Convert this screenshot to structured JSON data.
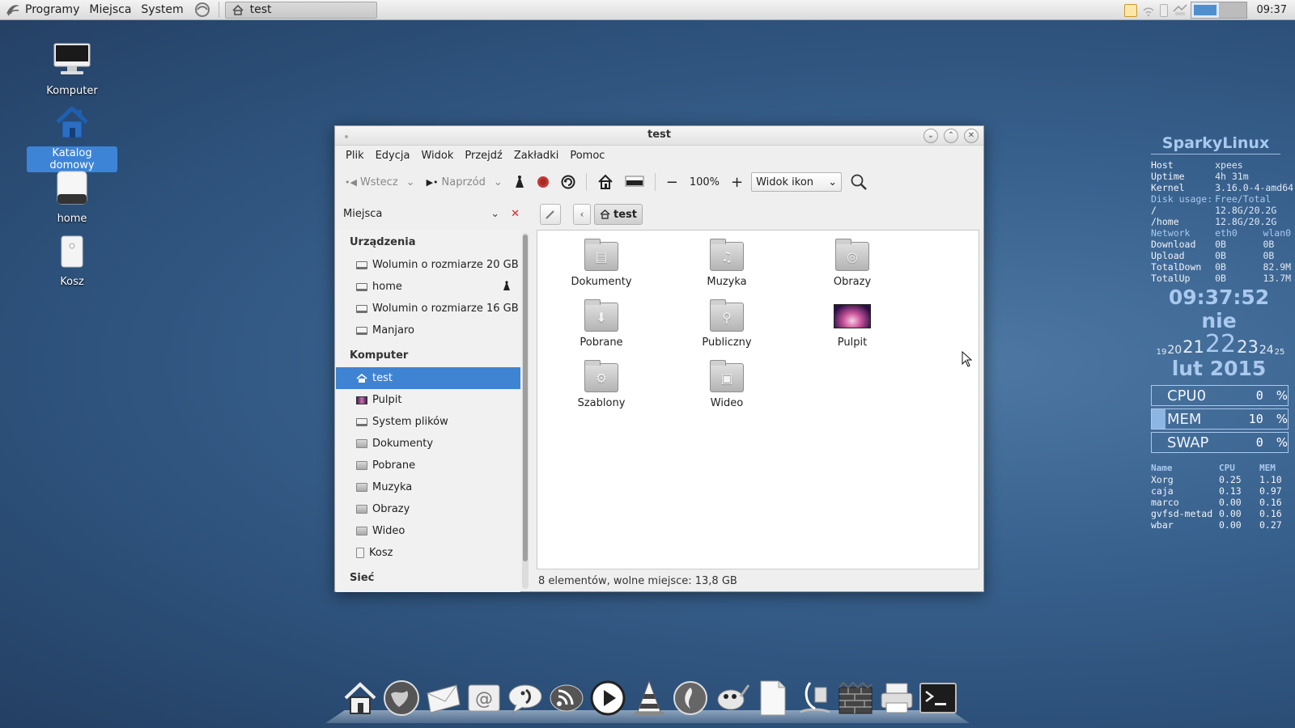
{
  "panel": {
    "menus": [
      "Programy",
      "Miejsca",
      "System"
    ],
    "task_title": "test",
    "clock": "09:37"
  },
  "desktop_icons": [
    {
      "label": "Komputer"
    },
    {
      "label": "Katalog domowy",
      "selected": true
    },
    {
      "label": "home"
    },
    {
      "label": "Kosz"
    }
  ],
  "window": {
    "title": "test",
    "menubar": [
      "Plik",
      "Edycja",
      "Widok",
      "Przejdź",
      "Zakładki",
      "Pomoc"
    ],
    "toolbar": {
      "back_label": "Wstecz",
      "forward_label": "Naprzód",
      "zoom": "100%",
      "view_mode": "Widok ikon"
    },
    "sidebar_combo": "Miejsca",
    "breadcrumb": "test",
    "sidebar": {
      "devices_header": "Urządzenia",
      "devices": [
        "Wolumin o rozmiarze 20 GB",
        "home",
        "Wolumin o rozmiarze 16 GB",
        "Manjaro"
      ],
      "computer_header": "Komputer",
      "computer": [
        "test",
        "Pulpit",
        "System plików",
        "Dokumenty",
        "Pobrane",
        "Muzyka",
        "Obrazy",
        "Wideo",
        "Kosz"
      ],
      "network_header": "Sieć"
    },
    "files": [
      {
        "name": "Dokumenty",
        "icon": "document-folder-icon"
      },
      {
        "name": "Muzyka",
        "icon": "music-folder-icon"
      },
      {
        "name": "Obrazy",
        "icon": "pictures-folder-icon"
      },
      {
        "name": "Pobrane",
        "icon": "downloads-folder-icon"
      },
      {
        "name": "Publiczny",
        "icon": "public-folder-icon"
      },
      {
        "name": "Pulpit",
        "icon": "desktop-folder-icon"
      },
      {
        "name": "Szablony",
        "icon": "templates-folder-icon"
      },
      {
        "name": "Wideo",
        "icon": "video-folder-icon"
      }
    ],
    "status": "8 elementów, wolne miejsce: 13,8 GB"
  },
  "conky": {
    "brand": "SparkyLinux",
    "host_k": "Host",
    "host_v": "xpees",
    "uptime_k": "Uptime",
    "uptime_v": "4h 31m",
    "kernel_k": "Kernel",
    "kernel_v": "3.16.0-4-amd64",
    "disk_k": "Disk usage:",
    "disk_v": "Free/Total",
    "root_k": "/",
    "root_v": "12.8G/20.2G",
    "home_k": "/home",
    "home_v": "12.8G/20.2G",
    "net_k": "Network",
    "net_eth": "eth0",
    "net_wlan": "wlan0",
    "down_k": "Download",
    "down_eth": "0B",
    "down_wlan": "0B",
    "up_k": "Upload",
    "up_eth": "0B",
    "up_wlan": "0B",
    "tdown_k": "TotalDown",
    "tdown_eth": "0B",
    "tdown_wlan": "82.9M",
    "tup_k": "TotalUp",
    "tup_eth": "0B",
    "tup_wlan": "13.7M",
    "time": "09:37:52",
    "day": "nie",
    "calendar": [
      "19",
      "20",
      "21",
      "22",
      "23",
      "24",
      "25"
    ],
    "month": "lut 2015",
    "meters": [
      {
        "name": "CPU0",
        "value": "0",
        "pct": "%",
        "fill": 0
      },
      {
        "name": "MEM",
        "value": "10",
        "pct": "%",
        "fill": 10
      },
      {
        "name": "SWAP",
        "value": "0",
        "pct": "%",
        "fill": 0
      }
    ],
    "proc_head": {
      "name": "Name",
      "cpu": "CPU",
      "mem": "MEM"
    },
    "procs": [
      {
        "name": "Xorg",
        "cpu": "0.25",
        "mem": "1.10"
      },
      {
        "name": "caja",
        "cpu": "0.13",
        "mem": "0.97"
      },
      {
        "name": "marco",
        "cpu": "0.00",
        "mem": "0.16"
      },
      {
        "name": "gvfsd-metad",
        "cpu": "0.00",
        "mem": "0.16"
      },
      {
        "name": "wbar",
        "cpu": "0.00",
        "mem": "0.27"
      }
    ]
  },
  "dock_icons": [
    "home-icon",
    "web-browser-icon",
    "mail-icon",
    "email-icon",
    "chat-icon",
    "rss-icon",
    "media-player-icon",
    "vlc-icon",
    "burner-icon",
    "gimp-icon",
    "text-editor-icon",
    "office-icon",
    "firewall-icon",
    "printer-icon",
    "terminal-icon"
  ]
}
